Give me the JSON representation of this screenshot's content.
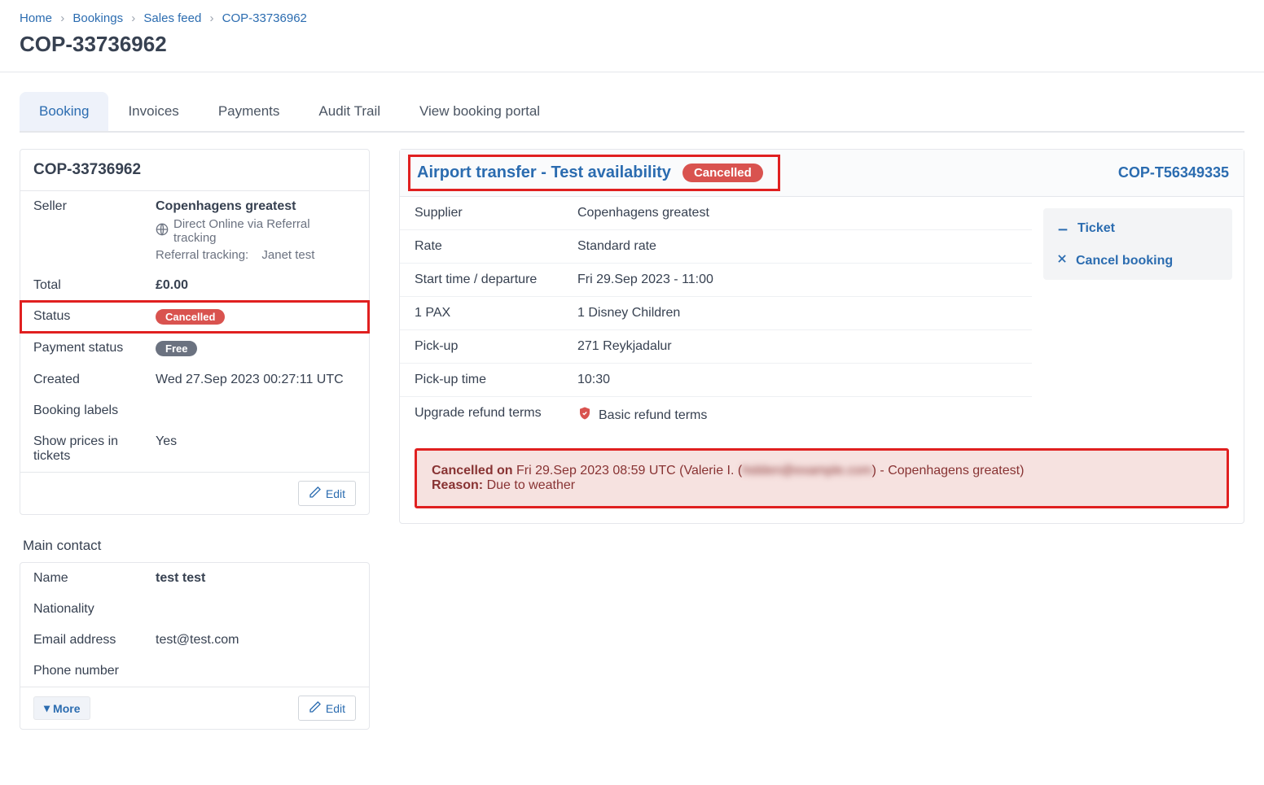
{
  "breadcrumb": {
    "home": "Home",
    "bookings": "Bookings",
    "sales_feed": "Sales feed",
    "current": "COP-33736962"
  },
  "page_title": "COP-33736962",
  "tabs": {
    "booking": "Booking",
    "invoices": "Invoices",
    "payments": "Payments",
    "audit_trail": "Audit Trail",
    "view_portal": "View booking portal"
  },
  "booking_card": {
    "header": "COP-33736962",
    "seller_label": "Seller",
    "seller_name": "Copenhagens greatest",
    "seller_channel": "Direct Online via Referral tracking",
    "referral_label": "Referral tracking:",
    "referral_value": "Janet test",
    "total_label": "Total",
    "total_value": "£0.00",
    "status_label": "Status",
    "status_value": "Cancelled",
    "payment_status_label": "Payment status",
    "payment_status_value": "Free",
    "created_label": "Created",
    "created_value": "Wed 27.Sep 2023 00:27:11 UTC",
    "labels_label": "Booking labels",
    "show_prices_label": "Show prices in tickets",
    "show_prices_value": "Yes",
    "edit": "Edit"
  },
  "contact_section_title": "Main contact",
  "contact_card": {
    "name_label": "Name",
    "name_value": "test test",
    "nationality_label": "Nationality",
    "email_label": "Email address",
    "email_value": "test@test.com",
    "phone_label": "Phone number",
    "more": "More",
    "edit": "Edit"
  },
  "item": {
    "title": "Airport transfer - Test availability",
    "status_badge": "Cancelled",
    "ref": "COP-T56349335",
    "supplier_label": "Supplier",
    "supplier_value": "Copenhagens greatest",
    "rate_label": "Rate",
    "rate_value": "Standard rate",
    "start_label": "Start time / departure",
    "start_value": "Fri 29.Sep 2023 - 11:00",
    "pax_label": "1 PAX",
    "pax_value": "1 Disney Children",
    "pickup_label": "Pick-up",
    "pickup_value": "271 Reykjadalur",
    "pickup_time_label": "Pick-up time",
    "pickup_time_value": "10:30",
    "refund_label": "Upgrade refund terms",
    "refund_value": "Basic refund terms"
  },
  "actions": {
    "ticket": "Ticket",
    "cancel": "Cancel booking"
  },
  "cancel_info": {
    "cancelled_on_label": "Cancelled on",
    "cancelled_on_value": "Fri 29.Sep 2023 08:59 UTC (Valerie I. (",
    "hidden_part": "hidden@example.com",
    "after_hidden": ") - Copenhagens greatest)",
    "reason_label": "Reason:",
    "reason_value": "Due to weather"
  }
}
